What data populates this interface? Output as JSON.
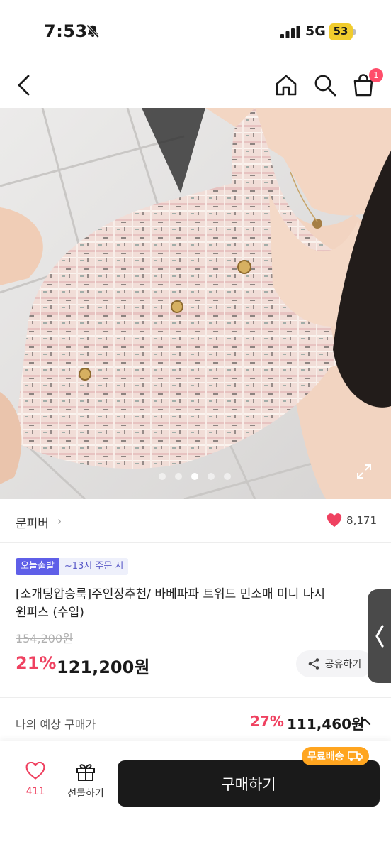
{
  "status": {
    "time": "7:53",
    "network": "5G",
    "battery": "53"
  },
  "nav": {
    "back_icon": "chevron-left-icon",
    "home_icon": "home-icon",
    "search_icon": "search-icon",
    "cart_icon": "shopping-bag-icon",
    "cart_count": "1"
  },
  "gallery": {
    "dot_count": 5,
    "active_dot": 3
  },
  "seller": {
    "name": "문피버",
    "chevron": "›",
    "likes": "8,171"
  },
  "product": {
    "badge_today": "오늘출발",
    "badge_time": "~13시 주문 시",
    "title_line1": "[소개팅압승룩]주인장추천/ 바베파파 트위드 민소매 미니 나시",
    "title_line2": "원피스 (수입)",
    "original_price": "154,200원",
    "discount": "21%",
    "sale_price": "121,200원",
    "share_label": "공유하기"
  },
  "expected": {
    "label": "나의 예상 구매가",
    "discount": "27%",
    "price": "111,460원"
  },
  "bottom": {
    "like_count": "411",
    "gift_label": "선물하기",
    "buy_label": "구매하기",
    "free_ship_label": "무료배송"
  },
  "colors": {
    "accent_red": "#ef4160",
    "badge_purple": "#5f5fe8",
    "free_ship_orange": "#ffa51f",
    "buy_button": "#1a1a1a"
  }
}
